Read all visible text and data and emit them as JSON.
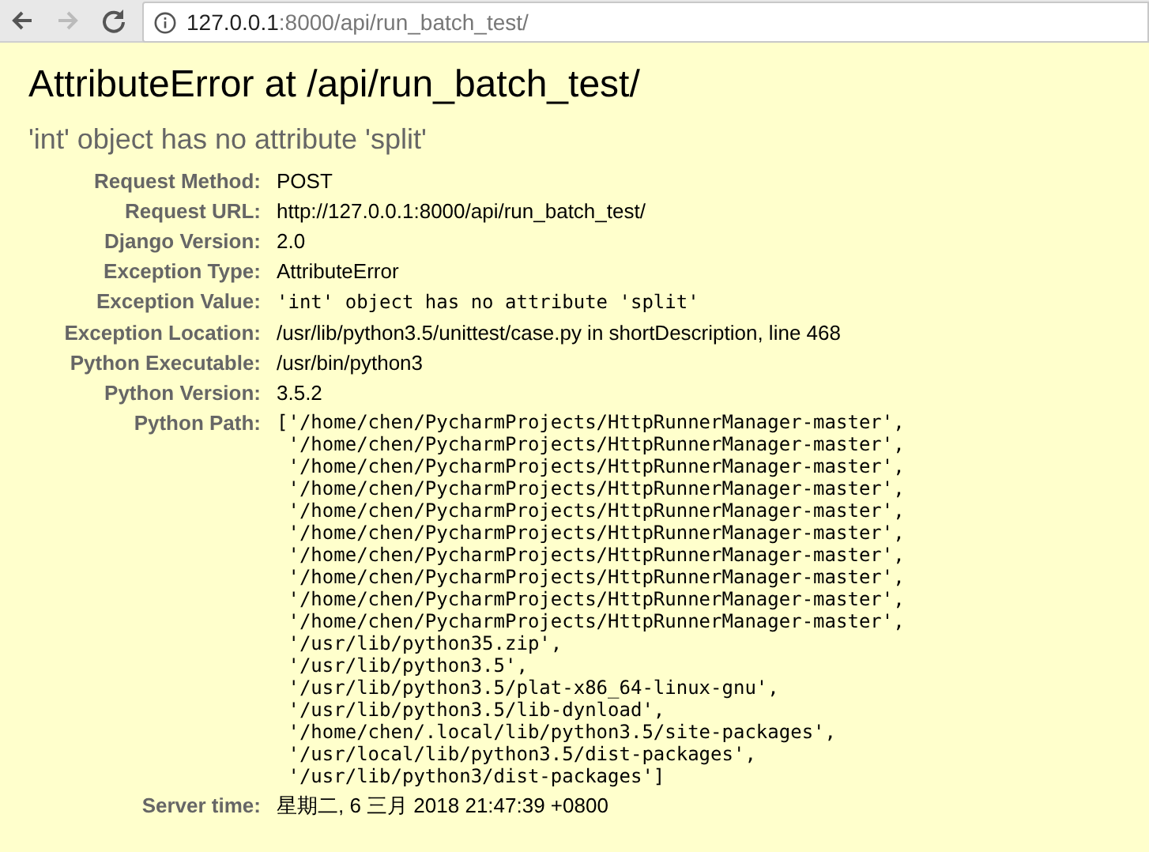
{
  "toolbar": {
    "nav_buttons": [
      {
        "kind": "back",
        "disabled": false
      },
      {
        "kind": "forward",
        "disabled": true
      },
      {
        "kind": "reload",
        "disabled": false
      }
    ],
    "address": {
      "host": "127.0.0.1",
      "path": ":8000/api/run_batch_test/"
    }
  },
  "title": "AttributeError at /api/run_batch_test/",
  "subtitle": "'int' object has no attribute 'split'",
  "rows": [
    {
      "label": "Request Method:",
      "kind": "text",
      "value": "POST"
    },
    {
      "label": "Request URL:",
      "kind": "text",
      "value": "http://127.0.0.1:8000/api/run_batch_test/"
    },
    {
      "label": "Django Version:",
      "kind": "text",
      "value": "2.0"
    },
    {
      "label": "Exception Type:",
      "kind": "text",
      "value": "AttributeError"
    },
    {
      "label": "Exception Value:",
      "kind": "mono",
      "value": "'int' object has no attribute 'split'"
    },
    {
      "label": "Exception Location:",
      "kind": "text",
      "value": "/usr/lib/python3.5/unittest/case.py in shortDescription, line 468"
    },
    {
      "label": "Python Executable:",
      "kind": "text",
      "value": "/usr/bin/python3"
    },
    {
      "label": "Python Version:",
      "kind": "text",
      "value": "3.5.2"
    },
    {
      "label": "Python Path:",
      "kind": "list",
      "lines": [
        "['/home/chen/PycharmProjects/HttpRunnerManager-master',",
        " '/home/chen/PycharmProjects/HttpRunnerManager-master',",
        " '/home/chen/PycharmProjects/HttpRunnerManager-master',",
        " '/home/chen/PycharmProjects/HttpRunnerManager-master',",
        " '/home/chen/PycharmProjects/HttpRunnerManager-master',",
        " '/home/chen/PycharmProjects/HttpRunnerManager-master',",
        " '/home/chen/PycharmProjects/HttpRunnerManager-master',",
        " '/home/chen/PycharmProjects/HttpRunnerManager-master',",
        " '/home/chen/PycharmProjects/HttpRunnerManager-master',",
        " '/home/chen/PycharmProjects/HttpRunnerManager-master',",
        " '/usr/lib/python35.zip',",
        " '/usr/lib/python3.5',",
        " '/usr/lib/python3.5/plat-x86_64-linux-gnu',",
        " '/usr/lib/python3.5/lib-dynload',",
        " '/home/chen/.local/lib/python3.5/site-packages',",
        " '/usr/local/lib/python3.5/dist-packages',",
        " '/usr/lib/python3/dist-packages']"
      ]
    },
    {
      "label": "Server time:",
      "kind": "text",
      "value": "星期二, 6 三月 2018 21:47:39 +0800"
    }
  ]
}
